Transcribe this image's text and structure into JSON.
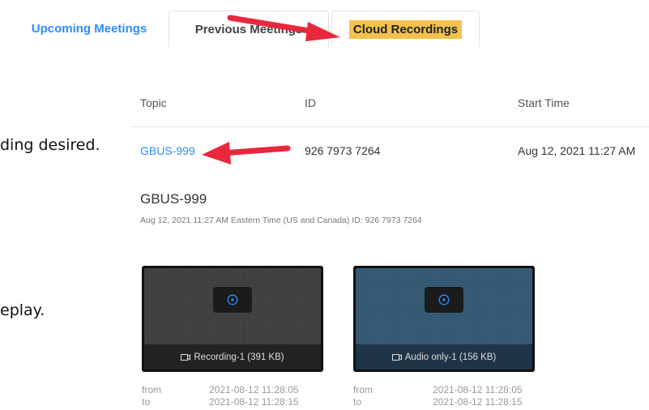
{
  "tabs": {
    "upcoming": "Upcoming Meetings",
    "previous": "Previous Meetings",
    "cloud": "Cloud Recordings"
  },
  "instructions": {
    "line1": "ding desired.",
    "line2": "eplay."
  },
  "table": {
    "headers": {
      "topic": "Topic",
      "id": "ID",
      "start": "Start Time"
    },
    "row": {
      "topic": "GBUS-999",
      "id": "926 7973 7264",
      "start": "Aug 12, 2021 11:27 AM"
    }
  },
  "detail": {
    "title": "GBUS-999",
    "subtitle": "Aug 12, 2021 11:27 AM Eastern Time (US and Canada)   ID: 926 7973 7264"
  },
  "recordings": [
    {
      "caption": "Recording-1 (391 KB)",
      "from_label": "from",
      "from_value": "2021-08-12 11:28:05",
      "to_label": "to",
      "to_value": "2021-08-12 11:28:15"
    },
    {
      "caption": "Audio only-1 (156 KB)",
      "from_label": "from",
      "from_value": "2021-08-12 11:28:05",
      "to_label": "to",
      "to_value": "2021-08-12 11:28:15"
    }
  ],
  "colors": {
    "accent": "#2d8cff",
    "highlight": "#f2c14e",
    "arrow": "#e8283c"
  },
  "icons": {
    "play": "play-circle-icon",
    "video": "video-camera-icon",
    "arrow": "red-arrow-annotation"
  }
}
